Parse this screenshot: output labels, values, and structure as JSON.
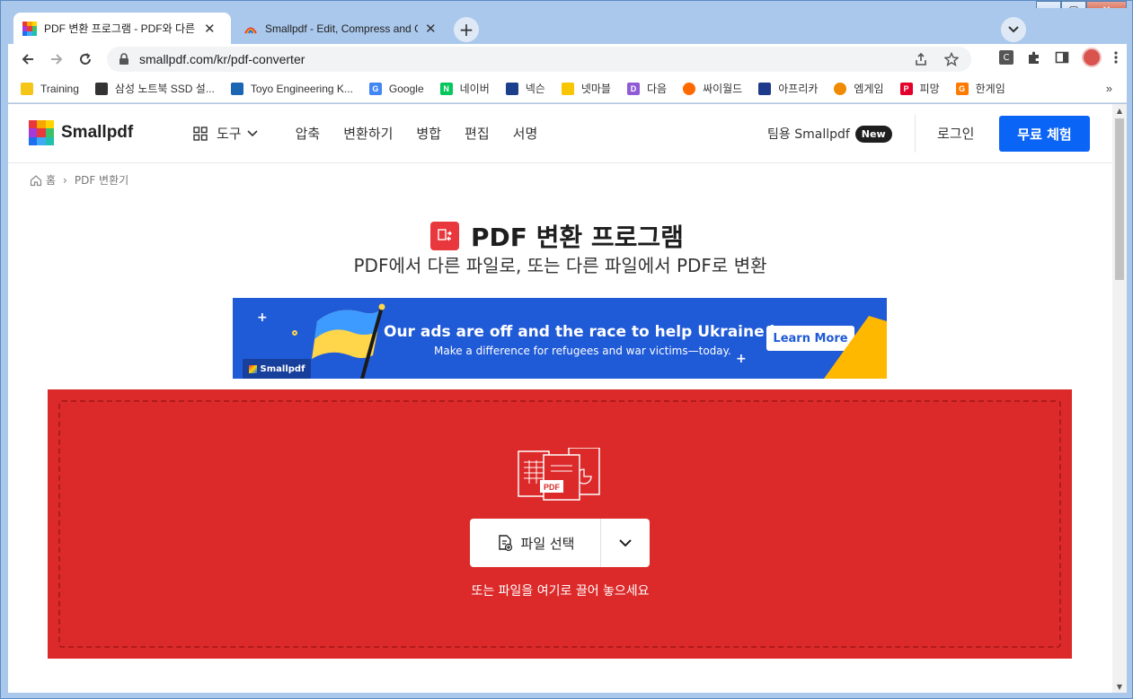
{
  "browser": {
    "tabs": [
      {
        "title": "PDF 변환 프로그램 - PDF와 다른",
        "close": "✕"
      },
      {
        "title": "Smallpdf - Edit, Compress and Co",
        "close": "✕"
      }
    ],
    "new_tab": "+",
    "url": "smallpdf.com/kr/pdf-converter",
    "ext_c_label": "C",
    "bookmarks": [
      {
        "label": "Training",
        "color": "#f5c518"
      },
      {
        "label": "삼성 노트북 SSD 설...",
        "color": "#333333"
      },
      {
        "label": "Toyo Engineering K...",
        "color": "#1a66b3"
      },
      {
        "label": "Google",
        "color": "#4285f4"
      },
      {
        "label": "네이버",
        "color": "#03c75a"
      },
      {
        "label": "넥슨",
        "color": "#1b3f8b"
      },
      {
        "label": "넷마블",
        "color": "#f7c600"
      },
      {
        "label": "다음",
        "color": "#8f5bd6"
      },
      {
        "label": "싸이월드",
        "color": "#ff6a00"
      },
      {
        "label": "아프리카",
        "color": "#1e3a8a"
      },
      {
        "label": "엠게임",
        "color": "#f08a00"
      },
      {
        "label": "피망",
        "color": "#e4002b"
      },
      {
        "label": "한게임",
        "color": "#ff7a00"
      }
    ],
    "bookmarks_more": "»"
  },
  "site": {
    "logo_text": "Smallpdf",
    "nav": {
      "tools": "도구",
      "items": [
        "압축",
        "변환하기",
        "병합",
        "편집",
        "서명"
      ]
    },
    "team_label": "팀용 Smallpdf",
    "new_badge": "New",
    "login": "로그인",
    "trial": "무료 체험"
  },
  "breadcrumb": {
    "home": "홈",
    "sep": "›",
    "current": "PDF 변환기"
  },
  "hero": {
    "title": "PDF 변환 프로그램",
    "subtitle": "PDF에서 다른 파일로, 또는 다른 파일에서 PDF로 변환"
  },
  "banner": {
    "headline": "Our ads are off and the race to help Ukraine is on",
    "sub": "Make a difference for refugees and war victims—today.",
    "cta": "Learn More",
    "tag": "Smallpdf"
  },
  "dropzone": {
    "choose_label": "파일 선택",
    "hint": "또는 파일을 여기로 끌어 놓으세요",
    "illustration_label": "PDF"
  },
  "colors": {
    "accent_blue": "#0a64f6",
    "drop_red": "#dc2a2a",
    "banner_blue": "#1f5ad7"
  }
}
